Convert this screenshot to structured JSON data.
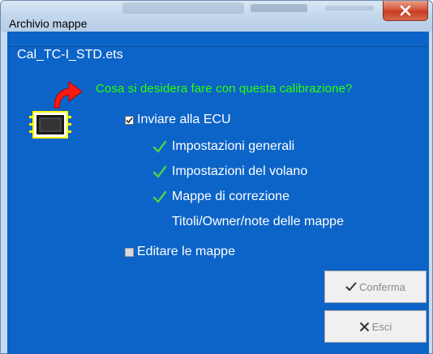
{
  "window": {
    "title": "Archivio mappe",
    "close_label": "X"
  },
  "file": {
    "name": "Cal_TC-I_STD.ets"
  },
  "prompt": {
    "question": "Cosa si desidera fare con questa calibrazione?"
  },
  "options": {
    "send": {
      "label": "Inviare alla ECU",
      "checked": true
    },
    "sub_items": [
      {
        "label": "Impostazioni generali",
        "checked": true
      },
      {
        "label": "Impostazioni del volano",
        "checked": true
      },
      {
        "label": "Mappe di correzione",
        "checked": true
      },
      {
        "label": "Titoli/Owner/note delle mappe",
        "checked": false
      }
    ],
    "edit": {
      "label": "Editare le mappe",
      "checked": false,
      "enabled": false
    }
  },
  "buttons": {
    "confirm_label": "Conferma",
    "exit_label": "Esci"
  },
  "colors": {
    "client_bg": "#0c64c8",
    "question_text": "#2cff00",
    "check_green": "#4cd24c"
  },
  "icons": {
    "arrow": "red-curved-arrow-icon",
    "chip": "ecu-chip-icon",
    "check": "green-check-icon",
    "confirm": "checkmark-icon",
    "exit": "x-icon"
  }
}
